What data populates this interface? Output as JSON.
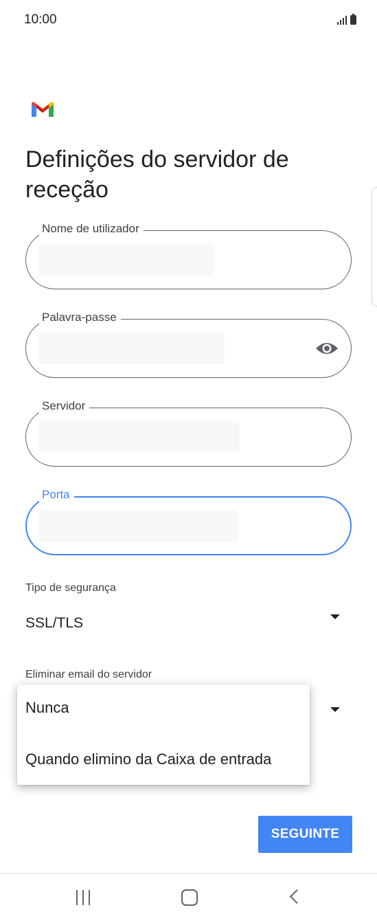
{
  "status_bar": {
    "time": "10:00"
  },
  "header": {
    "title": "Definições do servidor de receção"
  },
  "fields": {
    "username": {
      "label": "Nome de utilizador"
    },
    "password": {
      "label": "Palavra-passe"
    },
    "server": {
      "label": "Servidor"
    },
    "port": {
      "label": "Porta"
    }
  },
  "security": {
    "label": "Tipo de segurança",
    "value": "SSL/TLS"
  },
  "delete_email": {
    "label": "Eliminar email do servidor",
    "options": [
      "Nunca",
      "Quando elimino da Caixa de entrada"
    ]
  },
  "actions": {
    "next_label": "SEGUINTE"
  },
  "colors": {
    "accent": "#4285f4",
    "outline": "#5f6368",
    "text": "#202124"
  },
  "icons": {
    "logo": "gmail-logo-icon",
    "password_toggle": "eye-icon",
    "dropdown": "dropdown-arrow-icon"
  }
}
